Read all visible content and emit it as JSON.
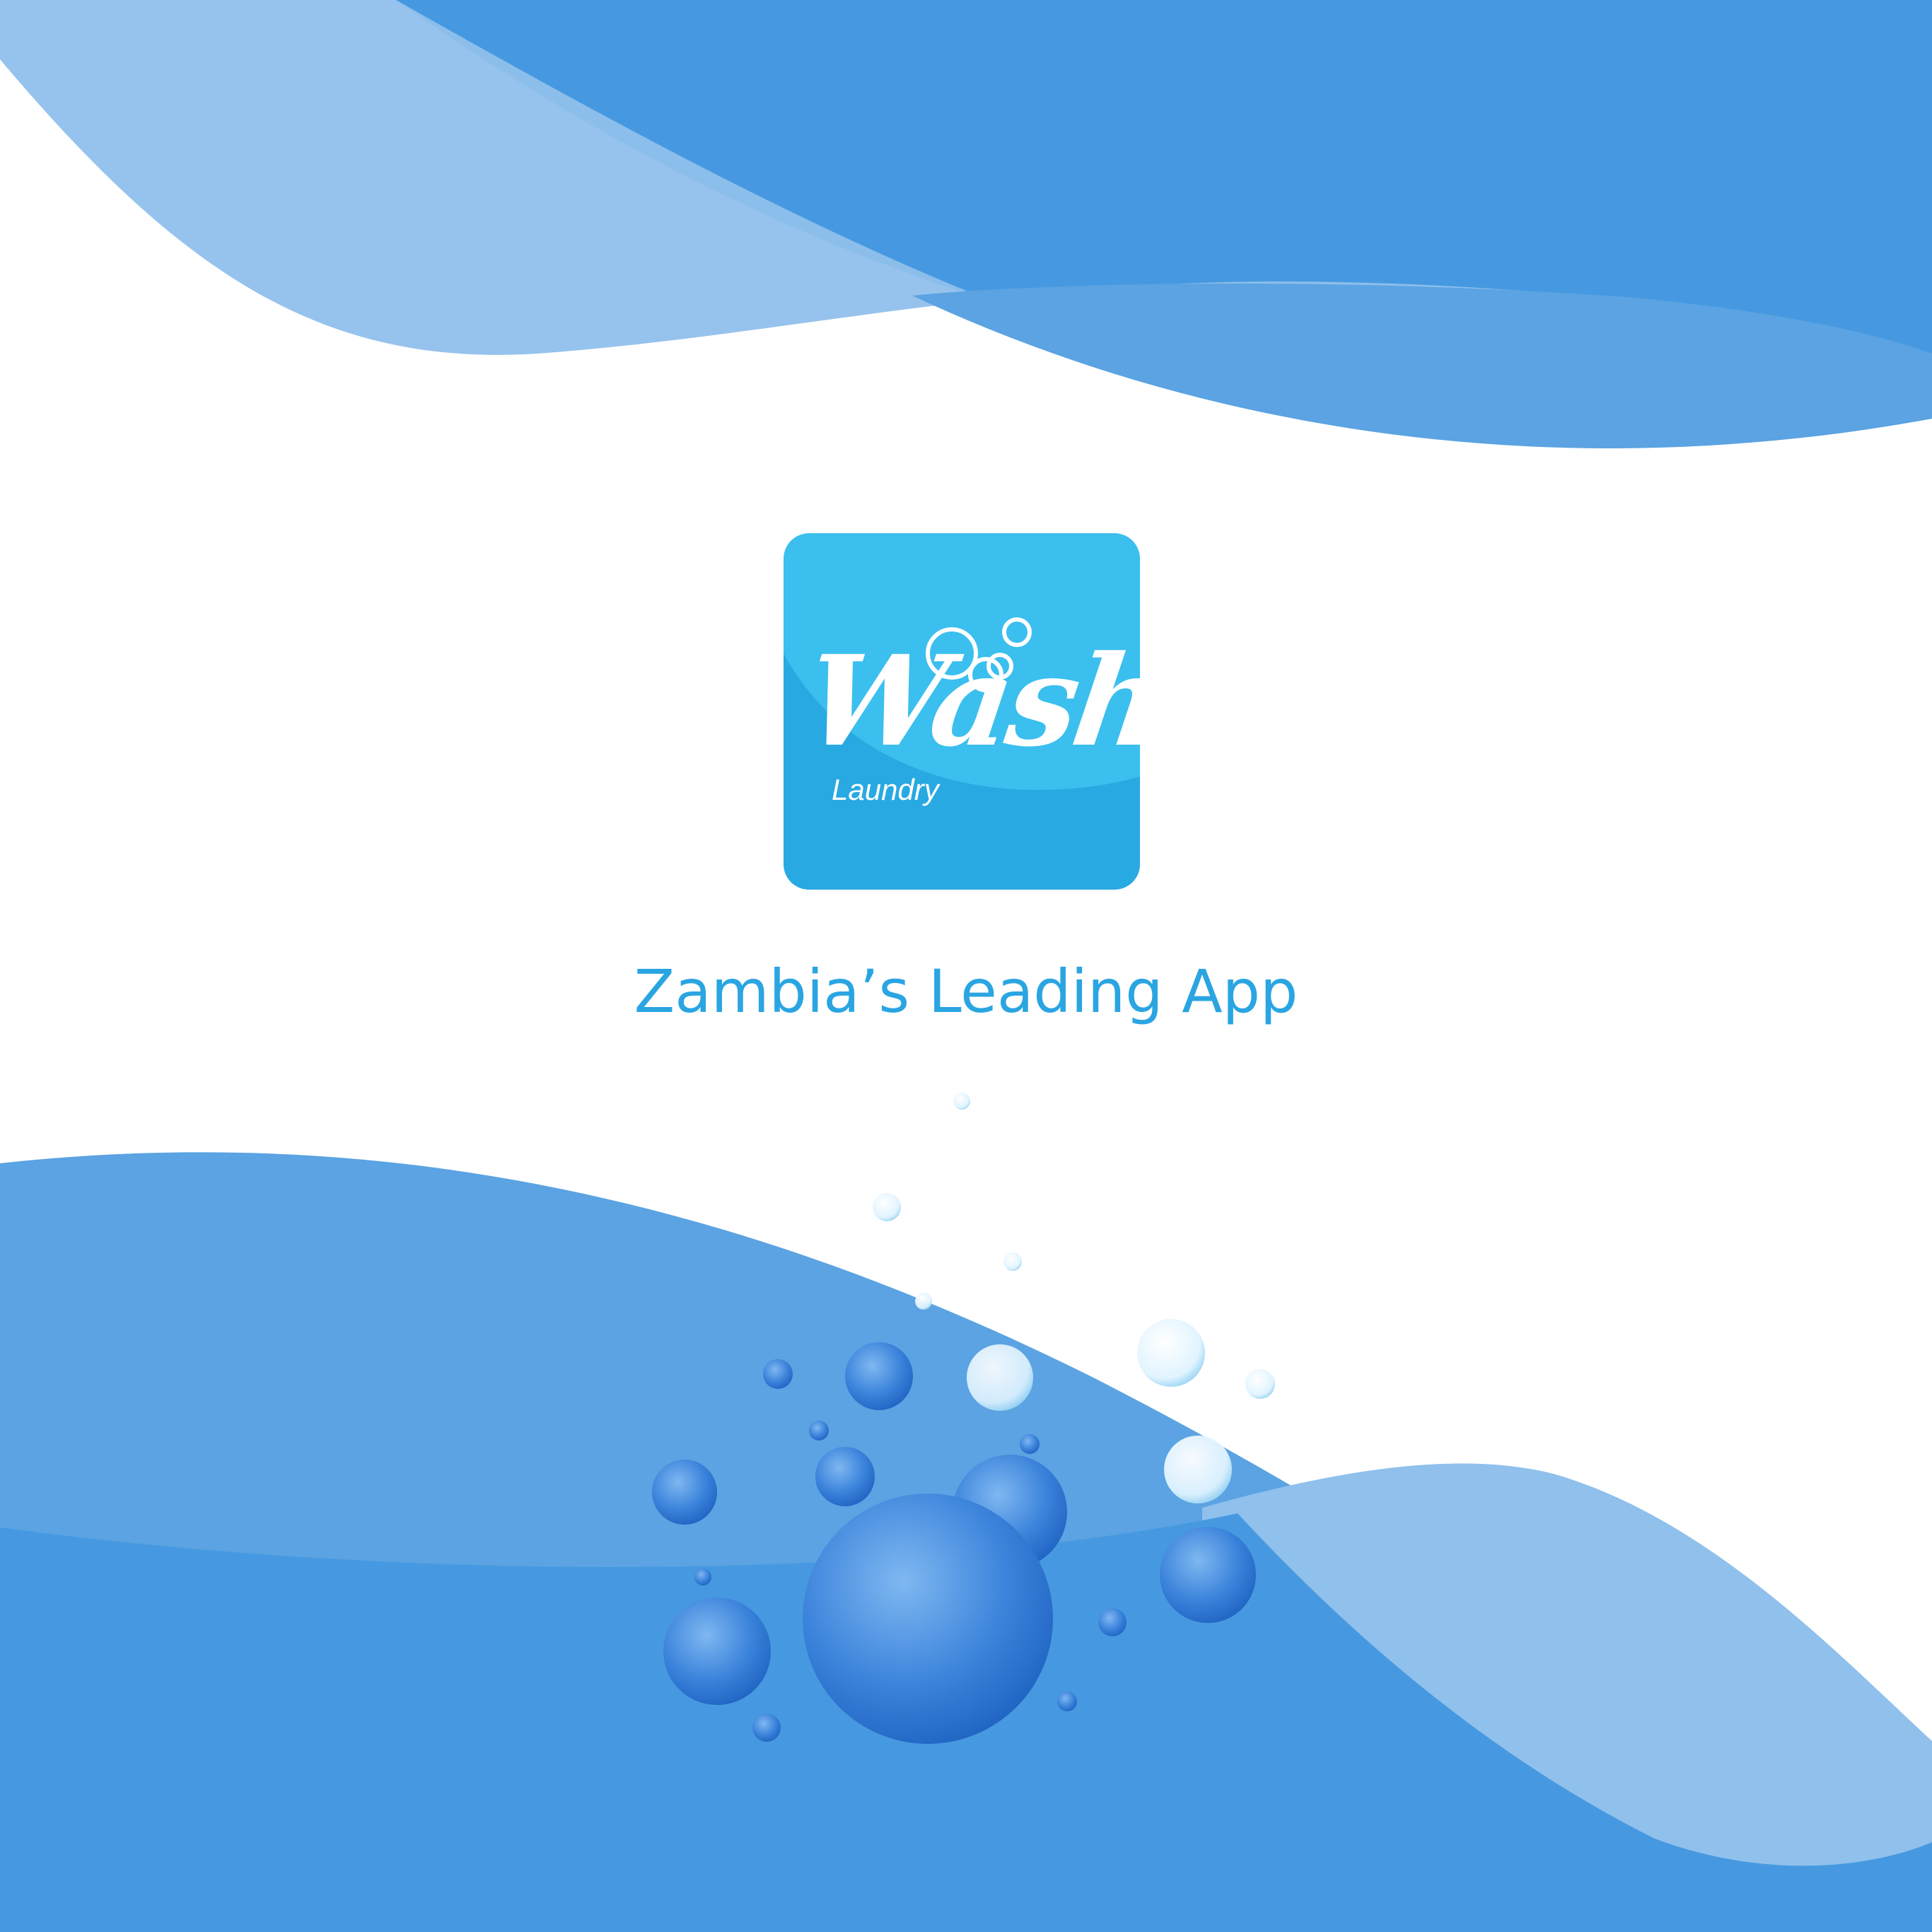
{
  "app": {
    "name": "Wash",
    "subtitle": "Laundry",
    "tagline": "Zambia’s Leading App"
  },
  "colors": {
    "wave_dark": "#4699e0",
    "wave_mid": "#5ba3e2",
    "wave_light": "#90c0ec",
    "icon_background": "#3bbfee",
    "icon_lower": "#29a9e2",
    "tagline": "#2aa5e2",
    "bubble_blue": "#2f78d6",
    "bubble_clear": "#e6f6ff"
  },
  "icons": [
    "wash-logo-icon",
    "soap-bubbles-icon",
    "decorative-bubble-cluster"
  ]
}
